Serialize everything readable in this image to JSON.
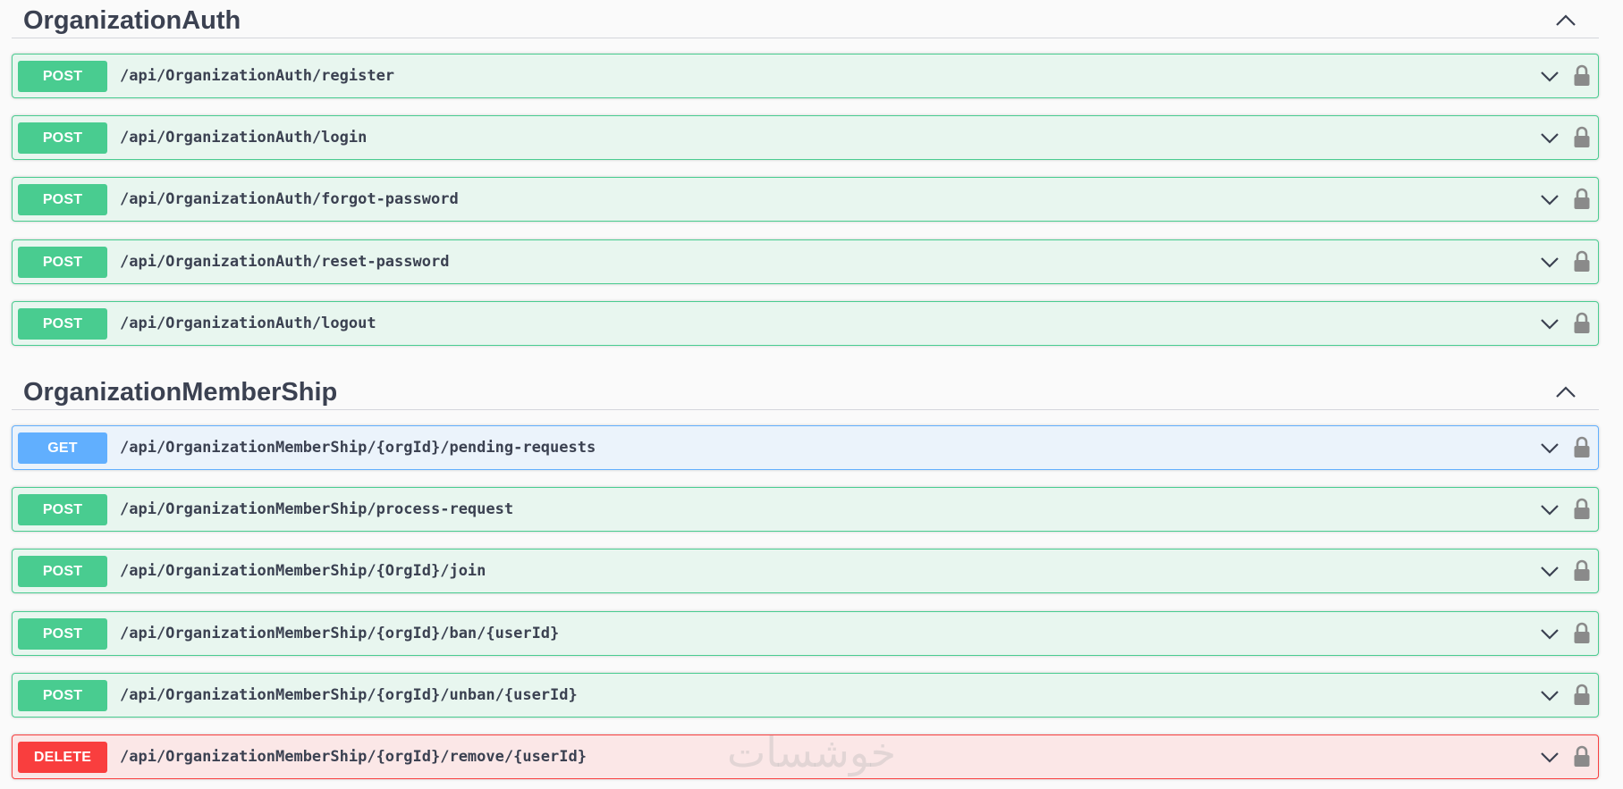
{
  "sections": [
    {
      "title": "OrganizationAuth",
      "operations": [
        {
          "method": "POST",
          "path": "/api/OrganizationAuth/register"
        },
        {
          "method": "POST",
          "path": "/api/OrganizationAuth/login"
        },
        {
          "method": "POST",
          "path": "/api/OrganizationAuth/forgot-password"
        },
        {
          "method": "POST",
          "path": "/api/OrganizationAuth/reset-password"
        },
        {
          "method": "POST",
          "path": "/api/OrganizationAuth/logout"
        }
      ]
    },
    {
      "title": "OrganizationMemberShip",
      "operations": [
        {
          "method": "GET",
          "path": "/api/OrganizationMemberShip/{orgId}/pending-requests"
        },
        {
          "method": "POST",
          "path": "/api/OrganizationMemberShip/process-request"
        },
        {
          "method": "POST",
          "path": "/api/OrganizationMemberShip/{OrgId}/join"
        },
        {
          "method": "POST",
          "path": "/api/OrganizationMemberShip/{orgId}/ban/{userId}"
        },
        {
          "method": "POST",
          "path": "/api/OrganizationMemberShip/{orgId}/unban/{userId}"
        },
        {
          "method": "DELETE",
          "path": "/api/OrganizationMemberShip/{orgId}/remove/{userId}"
        }
      ]
    }
  ],
  "icons": {
    "collapse": "chevron-up-icon",
    "expand": "chevron-down-icon",
    "auth": "lock-icon"
  },
  "colors": {
    "post": "#49cc90",
    "get": "#61affe",
    "delete": "#f93e3e"
  },
  "watermark": "خوشسات"
}
